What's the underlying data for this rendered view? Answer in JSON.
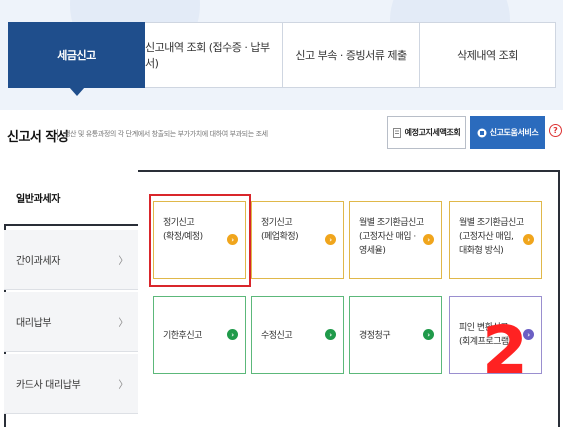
{
  "tabs": [
    {
      "label": "세금신고",
      "active": true
    },
    {
      "label": "신고내역 조회 (접수증 · 납부서)",
      "active": false
    },
    {
      "label": "신고 부속 · 증빙서류 제출",
      "active": false
    },
    {
      "label": "삭제내역 조회",
      "active": false
    }
  ],
  "section": {
    "title": "신고서 작성",
    "description": "생산 및 유통과정의 각 단계에서 창출되는 부가가치에 대하여 부과되는 조세"
  },
  "buttons": {
    "preview": "예정고지세액조회",
    "guide": "신고도움서비스",
    "help": "?"
  },
  "left_menu": [
    {
      "label": "일반과세자",
      "active": true
    },
    {
      "label": "간이과세자",
      "chevron": "〉"
    },
    {
      "label": "대리납부",
      "chevron": "〉"
    },
    {
      "label": "카드사 대리납부",
      "chevron": "〉"
    }
  ],
  "cards": {
    "regular_final_line1": "정기신고",
    "regular_final_line2": "(확정/예정)",
    "regular_closing_line1": "정기신고",
    "regular_closing_line2": "(폐업확정)",
    "monthly_early_a_line1": "월별 조기환급신고",
    "monthly_early_a_line2": "(고정자산 매입 ·",
    "monthly_early_a_line3": "영세율)",
    "monthly_early_b_line1": "월별 조기환급신고",
    "monthly_early_b_line2": "(고정자산 매입,",
    "monthly_early_b_line3": "대화형 방식)",
    "late": "기한후신고",
    "amend": "수정신고",
    "correction": "경정청구",
    "split_line1": "피인 변환신고",
    "split_line2": "(회계프로그램)",
    "arrow": "›"
  },
  "overlay_number": "2",
  "colors": {
    "active_tab": "#1f4e8c",
    "guide_button": "#2b6bbd",
    "highlight": "#d9262b",
    "overlay_number": "#ff2222"
  },
  "icons": {
    "preview": "document-icon",
    "guide": "book-icon"
  }
}
